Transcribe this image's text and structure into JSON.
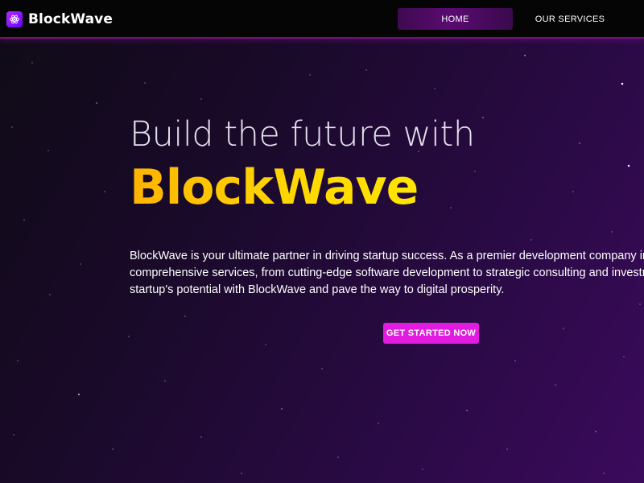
{
  "header": {
    "brand_name": "BlockWave",
    "logo_icon": "atom-icon",
    "nav": [
      {
        "label": "HOME",
        "active": true
      },
      {
        "label": "OUR SERVICES",
        "active": false
      }
    ]
  },
  "hero": {
    "title_line1": "Build the future with",
    "title_line2": "BlockWave",
    "description_lines": [
      "BlockWave is your ultimate partner in driving startup success. As a premier development company in",
      "comprehensive services, from cutting-edge software development to strategic consulting and investm",
      "startup's potential with BlockWave and pave the way to digital prosperity."
    ],
    "cta_label": "GET STARTED NOW"
  },
  "colors": {
    "header_bg": "#050505",
    "header_border": "#7a0f7a",
    "accent_yellow": "#ffd400",
    "cta_magenta": "#e21be0",
    "logo_purple": "#9a1fff"
  }
}
